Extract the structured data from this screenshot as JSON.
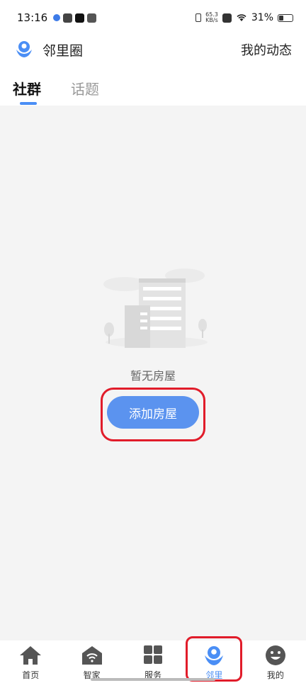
{
  "status_bar": {
    "time": "13:16",
    "net_speed_value": "65.3",
    "net_speed_unit": "KB/s",
    "battery": "31%"
  },
  "header": {
    "title": "邻里圈",
    "my_activity": "我的动态"
  },
  "tabs": [
    {
      "label": "社群",
      "active": true
    },
    {
      "label": "话题",
      "active": false
    }
  ],
  "empty_state": {
    "message": "暂无房屋",
    "button_label": "添加房屋"
  },
  "bottom_nav": [
    {
      "label": "首页",
      "icon": "home-icon"
    },
    {
      "label": "智家",
      "icon": "smart-home-icon"
    },
    {
      "label": "服务",
      "icon": "services-icon"
    },
    {
      "label": "邻里",
      "icon": "neighbors-icon",
      "active": true
    },
    {
      "label": "我的",
      "icon": "profile-icon"
    }
  ],
  "colors": {
    "accent": "#4a8ef5",
    "button": "#5b93ef",
    "highlight": "#e11c2a",
    "content_bg": "#f4f4f4"
  }
}
